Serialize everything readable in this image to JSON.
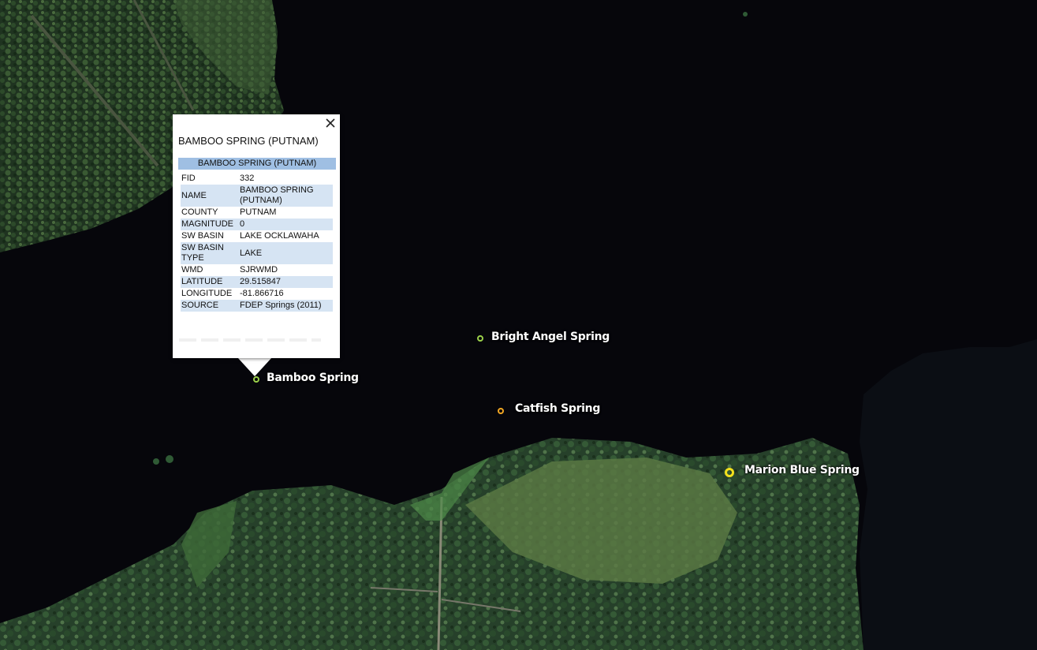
{
  "map": {
    "features": [
      {
        "id": "bright-angel",
        "label": "Bright Angel Spring",
        "marker_color": "#9bd04a",
        "marker_size": "small"
      },
      {
        "id": "bamboo",
        "label": "Bamboo Spring",
        "marker_color": "#9bd04a",
        "marker_size": "small"
      },
      {
        "id": "catfish",
        "label": "Catfish Spring",
        "marker_color": "#f0a623",
        "marker_size": "small"
      },
      {
        "id": "marion-blue",
        "label": "Marion Blue Spring",
        "marker_color": "#f2e01c",
        "marker_size": "big"
      }
    ]
  },
  "popup": {
    "title": "BAMBOO SPRING (PUTNAM)",
    "header": "BAMBOO SPRING (PUTNAM)",
    "close_icon": "close-icon",
    "rows": [
      {
        "key": "FID",
        "value": "332"
      },
      {
        "key": "NAME",
        "value": "BAMBOO SPRING (PUTNAM)"
      },
      {
        "key": "COUNTY",
        "value": "PUTNAM"
      },
      {
        "key": "MAGNITUDE",
        "value": "0"
      },
      {
        "key": "SW BASIN",
        "value": "LAKE OCKLAWAHA"
      },
      {
        "key": "SW BASIN TYPE",
        "value": "LAKE"
      },
      {
        "key": "WMD",
        "value": "SJRWMD"
      },
      {
        "key": "LATITUDE",
        "value": "29.515847"
      },
      {
        "key": "LONGITUDE",
        "value": "-81.866716"
      },
      {
        "key": "SOURCE",
        "value": "FDEP Springs (2011)"
      }
    ]
  }
}
